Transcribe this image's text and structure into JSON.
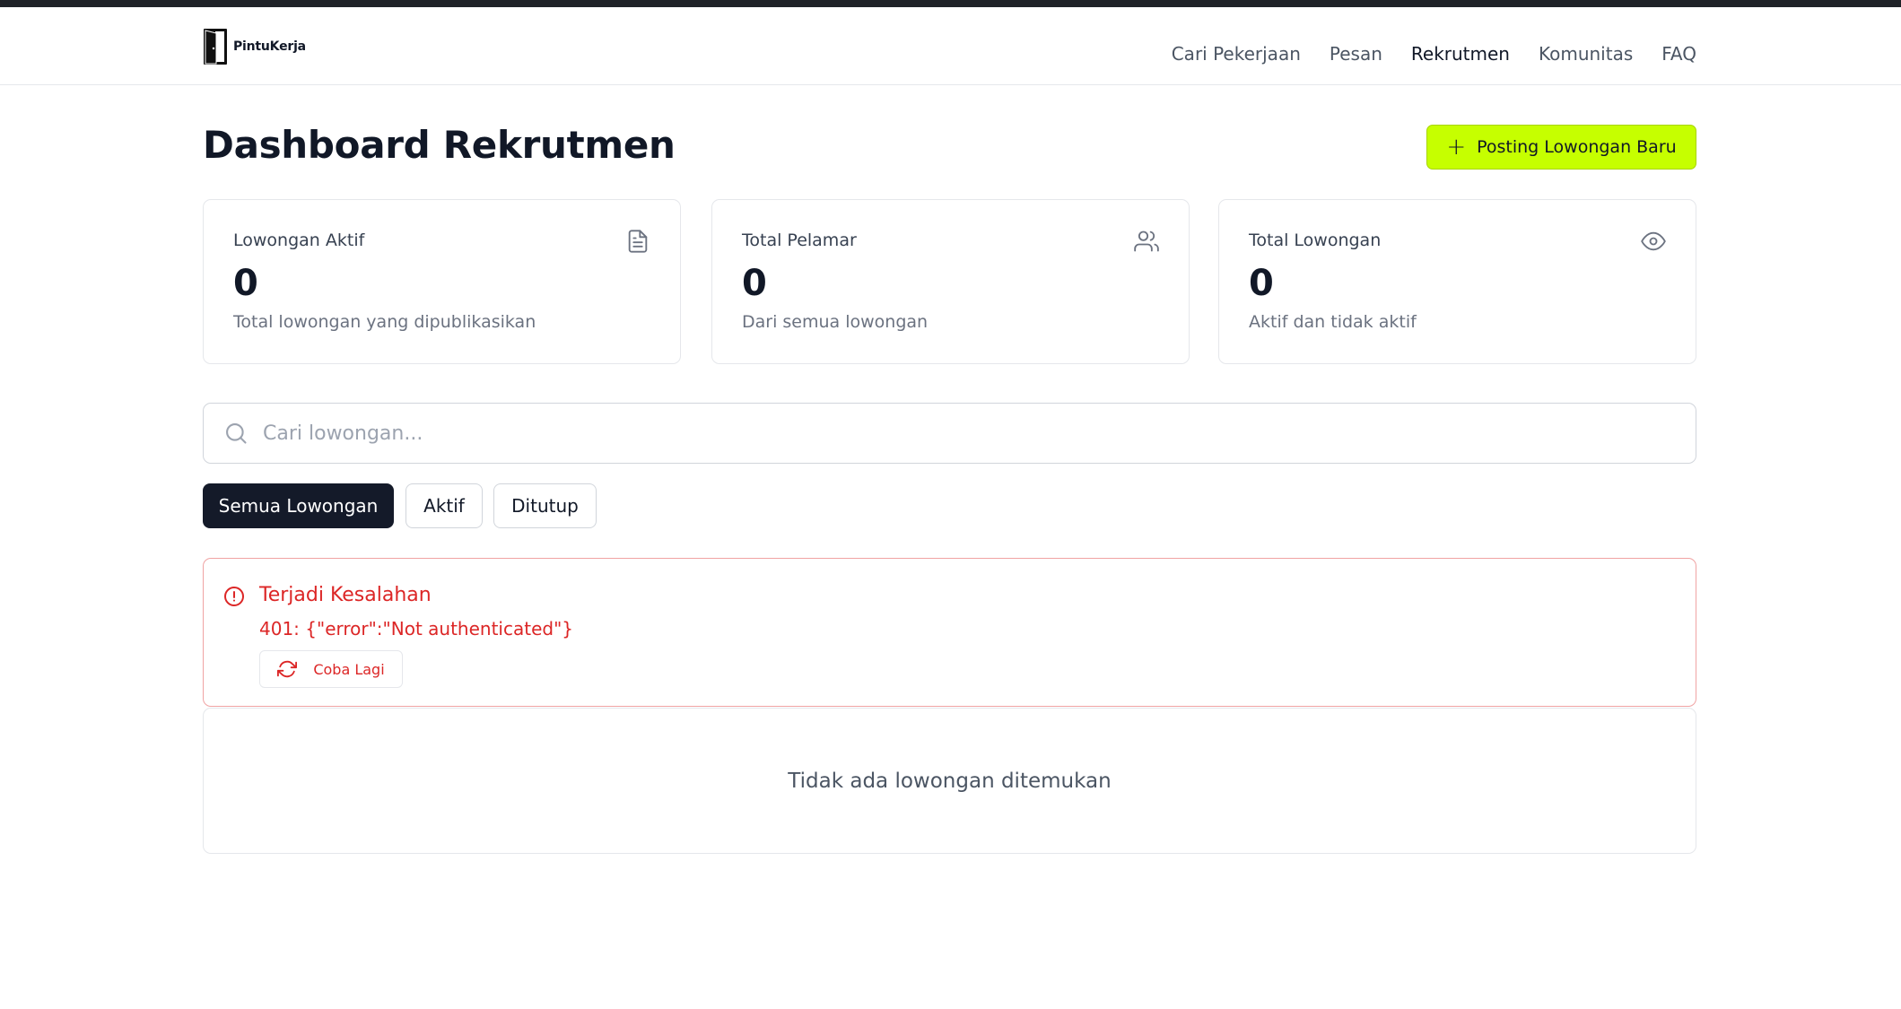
{
  "brand": {
    "name": "PintuKerja"
  },
  "nav": {
    "items": [
      {
        "label": "Cari Pekerjaan",
        "active": false
      },
      {
        "label": "Pesan",
        "active": false
      },
      {
        "label": "Rekrutmen",
        "active": true
      },
      {
        "label": "Komunitas",
        "active": false
      },
      {
        "label": "FAQ",
        "active": false
      }
    ]
  },
  "page": {
    "title": "Dashboard Rekrutmen",
    "post_button_label": "Posting Lowongan Baru"
  },
  "stats": [
    {
      "label": "Lowongan Aktif",
      "value": "0",
      "sub": "Total lowongan yang dipublikasikan",
      "icon": "document-icon"
    },
    {
      "label": "Total Pelamar",
      "value": "0",
      "sub": "Dari semua lowongan",
      "icon": "users-icon"
    },
    {
      "label": "Total Lowongan",
      "value": "0",
      "sub": "Aktif dan tidak aktif",
      "icon": "eye-icon"
    }
  ],
  "search": {
    "placeholder": "Cari lowongan...",
    "value": ""
  },
  "filters": [
    {
      "label": "Semua Lowongan",
      "active": true
    },
    {
      "label": "Aktif",
      "active": false
    },
    {
      "label": "Ditutup",
      "active": false
    }
  ],
  "error": {
    "title": "Terjadi Kesalahan",
    "message": "401: {\"error\":\"Not authenticated\"}",
    "retry_label": "Coba Lagi"
  },
  "empty_state": {
    "message": "Tidak ada lowongan ditemukan"
  },
  "colors": {
    "accent": "#c6ff00",
    "dark": "#141a29",
    "error": "#dc2626",
    "topbar": "#1f2328"
  }
}
